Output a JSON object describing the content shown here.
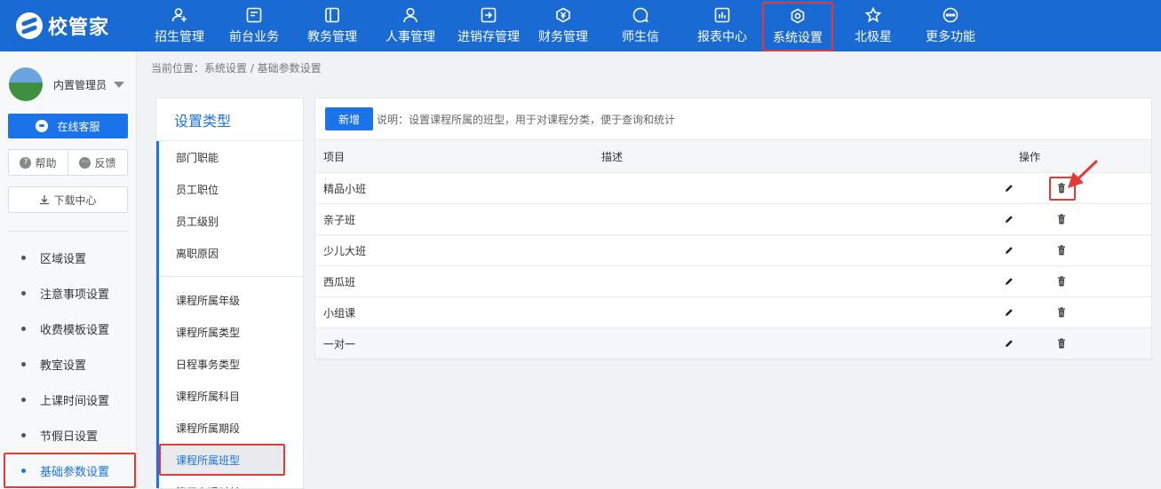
{
  "app": {
    "logo_text": "校管家"
  },
  "topnav": {
    "items": [
      {
        "label": "招生管理",
        "icon": "user-plus-icon"
      },
      {
        "label": "前台业务",
        "icon": "monitor-icon"
      },
      {
        "label": "教务管理",
        "icon": "book-icon"
      },
      {
        "label": "人事管理",
        "icon": "person-icon"
      },
      {
        "label": "进销存管理",
        "icon": "login-box-icon"
      },
      {
        "label": "财务管理",
        "icon": "yen-shield-icon"
      },
      {
        "label": "师生信",
        "icon": "chat-icon"
      },
      {
        "label": "报表中心",
        "icon": "bar-chart-icon"
      },
      {
        "label": "系统设置",
        "icon": "gear-icon",
        "active": true
      },
      {
        "label": "北极星",
        "icon": "star-icon"
      },
      {
        "label": "更多功能",
        "icon": "more-icon"
      }
    ]
  },
  "user": {
    "name": "内置管理员"
  },
  "sidebar": {
    "service_label": "在线客服",
    "help_label": "帮助",
    "feedback_label": "反馈",
    "download_label": "下载中心",
    "items": [
      {
        "label": "区域设置"
      },
      {
        "label": "注意事项设置"
      },
      {
        "label": "收费模板设置"
      },
      {
        "label": "教室设置"
      },
      {
        "label": "上课时间设置"
      },
      {
        "label": "节假日设置"
      },
      {
        "label": "基础参数设置",
        "active": true
      }
    ]
  },
  "breadcrumb": "当前位置：系统设置 / 基础参数设置",
  "types": {
    "title": "设置类型",
    "group1": [
      "部门职能",
      "员工职位",
      "员工级别",
      "离职原因"
    ],
    "group2": [
      "课程所属年级",
      "课程所属类型",
      "日程事务类型",
      "课程所属科目",
      "课程所属期段",
      "课程所属班型",
      "算用上课时长"
    ],
    "active": "课程所属班型"
  },
  "main": {
    "add_label": "新增",
    "description": "说明：设置课程所属的班型，用于对课程分类，便于查询和统计",
    "columns": {
      "name": "项目",
      "desc": "描述",
      "ops": "操作"
    },
    "rows": [
      {
        "name": "精品小班"
      },
      {
        "name": "亲子班"
      },
      {
        "name": "少儿大班"
      },
      {
        "name": "西瓜班"
      },
      {
        "name": "小组课"
      },
      {
        "name": "一对一"
      }
    ]
  },
  "colors": {
    "topbar": "#1a6ad4",
    "accent": "#1a73e8",
    "highlight": "#e53935"
  }
}
